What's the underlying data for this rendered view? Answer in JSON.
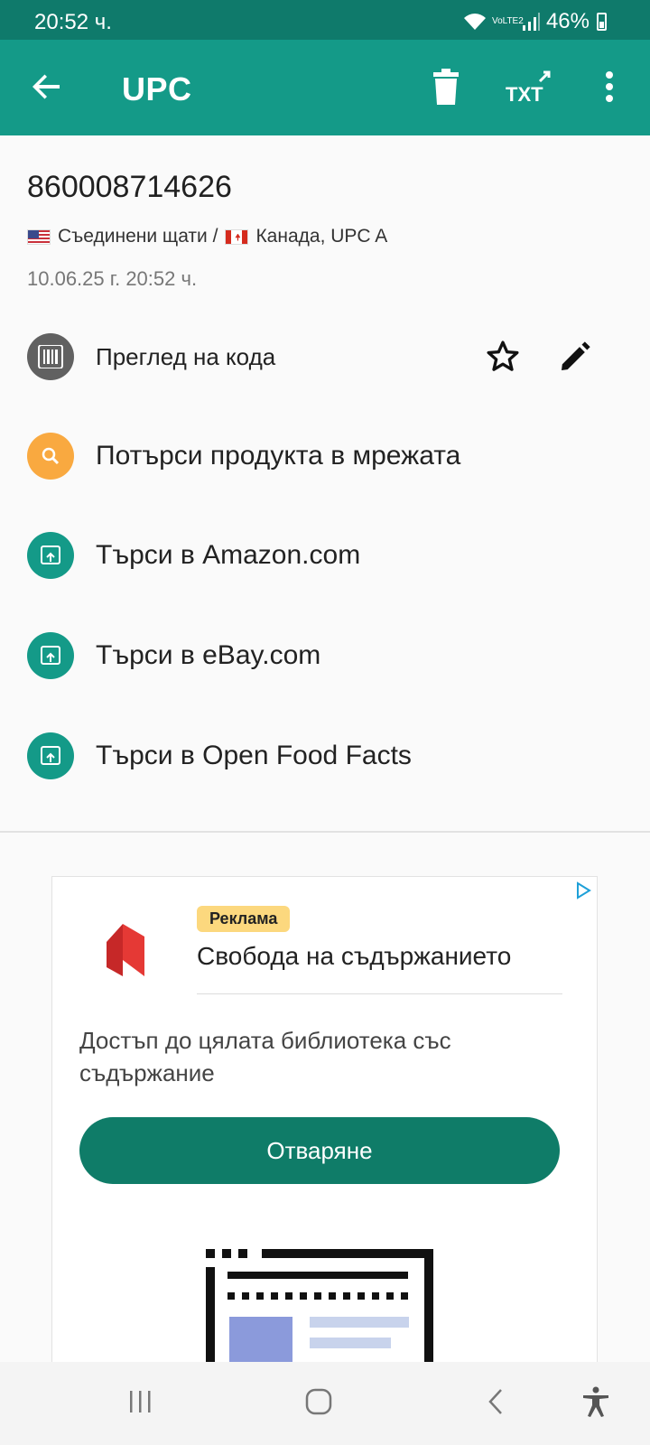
{
  "status_bar": {
    "time": "20:52 ч.",
    "network": "VoLTE2",
    "battery": "46%"
  },
  "app_bar": {
    "title": "UPC",
    "icons": [
      "back-arrow-icon",
      "trash-icon",
      "txt-export-icon",
      "more-vert-icon"
    ]
  },
  "barcode": {
    "value": "860008714626",
    "country_line": {
      "part1": "Съединени щати /",
      "part2": "Канада, UPC A"
    },
    "datetime": "10.06.25 г. 20:52 ч."
  },
  "actions": [
    {
      "label": "Преглед на кода",
      "icon": "barcode-icon",
      "color": "#616161"
    },
    {
      "label": "Потърси продукта в мрежата",
      "icon": "search-icon",
      "color": "#f9a940"
    },
    {
      "label": "Търси в Amazon.com",
      "icon": "open-in-browser-icon",
      "color": "#149a88"
    },
    {
      "label": "Търси в eBay.com",
      "icon": "open-in-browser-icon",
      "color": "#149a88"
    },
    {
      "label": "Търси в Open Food Facts",
      "icon": "open-in-browser-icon",
      "color": "#149a88"
    }
  ],
  "ad": {
    "badge": "Реклама",
    "headline": "Свобода на съдържанието",
    "body": "Достъп до цялата библиотека със съдържание",
    "button": "Отваряне"
  },
  "colors": {
    "primary": "#149a88",
    "primary_dark": "#0f7a6b",
    "ad_button": "#0f7c68",
    "search_accent": "#f9a940"
  }
}
